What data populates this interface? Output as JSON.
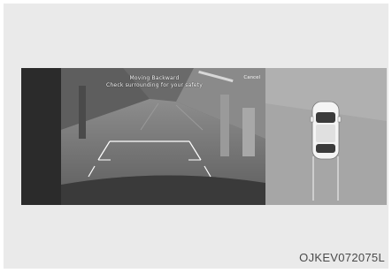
{
  "camera": {
    "message_line1": "Moving Backward",
    "message_line2": "Check surrounding for your safety",
    "cancel_label": "Cancel"
  },
  "figure_code": "OJKEV072075L"
}
